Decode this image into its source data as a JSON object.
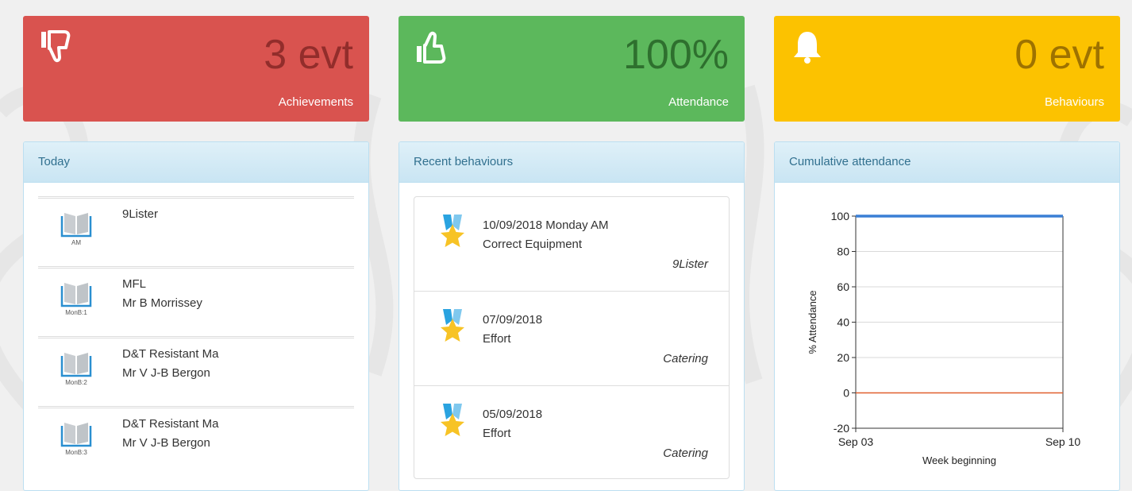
{
  "tiles": {
    "achievements": {
      "value": "3 evt",
      "label": "Achievements",
      "icon": "thumbs-down-icon",
      "color": "#d9534f"
    },
    "attendance": {
      "value": "100%",
      "label": "Attendance",
      "icon": "thumbs-up-icon",
      "color": "#5cb85c"
    },
    "behaviours": {
      "value": "0 evt",
      "label": "Behaviours",
      "icon": "bell-icon",
      "color": "#fcc200"
    }
  },
  "today": {
    "title": "Today",
    "items": [
      {
        "slot": "AM",
        "line1": "9Lister",
        "line2": ""
      },
      {
        "slot": "MonB:1",
        "line1": "MFL",
        "line2": "Mr B Morrissey"
      },
      {
        "slot": "MonB:2",
        "line1": "D&T Resistant Ma",
        "line2": "Mr V J-B Bergon"
      },
      {
        "slot": "MonB:3",
        "line1": "D&T Resistant Ma",
        "line2": "Mr V J-B Bergon"
      }
    ]
  },
  "recent": {
    "title": "Recent behaviours",
    "items": [
      {
        "date": "10/09/2018 Monday AM",
        "desc": "Correct Equipment",
        "where": "9Lister"
      },
      {
        "date": "07/09/2018",
        "desc": "Effort",
        "where": "Catering"
      },
      {
        "date": "05/09/2018",
        "desc": "Effort",
        "where": "Catering"
      }
    ]
  },
  "cumulative": {
    "title": "Cumulative attendance"
  },
  "chart_data": {
    "type": "line",
    "x": [
      "Sep 03",
      "Sep 10"
    ],
    "series": [
      {
        "values": [
          100,
          100
        ],
        "color": "#3a7fd5"
      },
      {
        "values": [
          0,
          0
        ],
        "color": "#e0602f"
      }
    ],
    "ylim": [
      -20,
      100
    ],
    "yticks": [
      -20,
      0,
      20,
      40,
      60,
      80,
      100
    ],
    "xlabel": "Week beginning",
    "ylabel": "% Attendance",
    "grid": true
  }
}
